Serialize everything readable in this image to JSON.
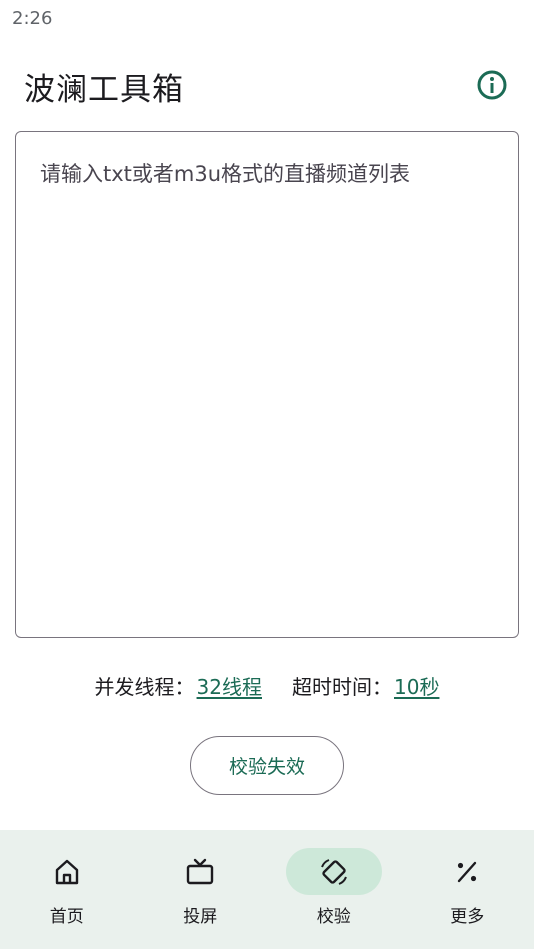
{
  "status_bar": {
    "time": "2:26"
  },
  "app_bar": {
    "title": "波澜工具箱",
    "info_icon": "info-circle-icon"
  },
  "input": {
    "placeholder": "请输入txt或者m3u格式的直播频道列表",
    "value": ""
  },
  "settings": {
    "concurrency_label": "并发线程：",
    "concurrency_value": "32线程",
    "timeout_label": "超时时间：",
    "timeout_value": "10秒"
  },
  "action_button": {
    "label": "校验失效"
  },
  "bottom_nav": {
    "items": [
      {
        "label": "首页",
        "icon": "home-icon",
        "active": false
      },
      {
        "label": "投屏",
        "icon": "tv-icon",
        "active": false
      },
      {
        "label": "校验",
        "icon": "rotate-device-icon",
        "active": true
      },
      {
        "label": "更多",
        "icon": "percent-icon",
        "active": false
      }
    ]
  },
  "colors": {
    "accent": "#1b6b55",
    "nav_background": "#eaf1ed",
    "nav_active_pill": "#cde8d9",
    "outline": "#79747e"
  }
}
